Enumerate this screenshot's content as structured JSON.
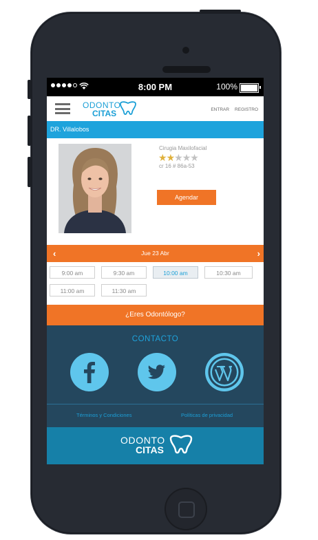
{
  "status_bar": {
    "time": "8:00 PM",
    "battery": "100%"
  },
  "header": {
    "logo_top": "ODONTO",
    "logo_bottom": "CITAS",
    "login_label": "ENTRAR",
    "register_label": "REGISTRO"
  },
  "doctor": {
    "name": "DR. Villalobos",
    "specialty": "Cirugia Maxilofacial",
    "rating": 2,
    "rating_max": 5,
    "address": "cr 16 # 86a-53",
    "schedule_button": "Agendar"
  },
  "date_nav": {
    "prev_icon": "chevron-left-icon",
    "date": "Jue 23 Abr",
    "next_icon": "chevron-right-icon"
  },
  "time_slots": [
    {
      "label": "9:00 am",
      "selected": false
    },
    {
      "label": "9:30 am",
      "selected": false
    },
    {
      "label": "10:00 am",
      "selected": true
    },
    {
      "label": "10:30 am",
      "selected": false
    },
    {
      "label": "11:00 am",
      "selected": false
    },
    {
      "label": "11:30 am",
      "selected": false
    }
  ],
  "dentist_cta": "¿Eres Odontólogo?",
  "contact": {
    "title": "CONTACTO",
    "social": [
      "facebook-icon",
      "twitter-icon",
      "wordpress-icon"
    ]
  },
  "legal": {
    "terms": "Términos y Condiciones",
    "privacy": "Políticas de privacidad"
  },
  "footer": {
    "logo_top": "ODONTO",
    "logo_bottom": "CITAS"
  },
  "colors": {
    "brand_blue": "#1ea3dc",
    "brand_orange": "#f07426",
    "contact_bg": "#24475e",
    "footer_bg": "#1680a8",
    "phone_body": "#272b33"
  }
}
